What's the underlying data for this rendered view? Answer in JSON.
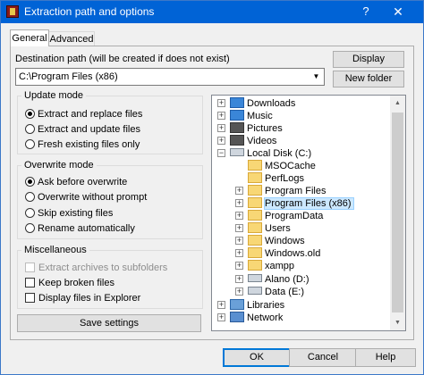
{
  "window": {
    "title": "Extraction path and options",
    "help_label": "?",
    "close_label": "✕"
  },
  "tabs": [
    {
      "label": "General",
      "active": true
    },
    {
      "label": "Advanced",
      "active": false
    }
  ],
  "destination": {
    "label": "Destination path (will be created if does not exist)",
    "value": "C:\\Program Files (x86)",
    "display_button": "Display",
    "new_folder_button": "New folder"
  },
  "update_mode": {
    "title": "Update mode",
    "options": [
      "Extract and replace files",
      "Extract and update files",
      "Fresh existing files only"
    ],
    "selected": 0
  },
  "overwrite_mode": {
    "title": "Overwrite mode",
    "options": [
      "Ask before overwrite",
      "Overwrite without prompt",
      "Skip existing files",
      "Rename automatically"
    ],
    "selected": 0
  },
  "misc": {
    "title": "Miscellaneous",
    "items": [
      {
        "label": "Extract archives to subfolders",
        "checked": false,
        "disabled": true
      },
      {
        "label": "Keep broken files",
        "checked": false,
        "disabled": false
      },
      {
        "label": "Display files in Explorer",
        "checked": false,
        "disabled": false
      }
    ]
  },
  "save_settings_button": "Save settings",
  "tree": [
    {
      "label": "Downloads",
      "icon": "download-folder-icon",
      "expander": "+"
    },
    {
      "label": "Music",
      "icon": "music-folder-icon",
      "expander": "+"
    },
    {
      "label": "Pictures",
      "icon": "pictures-folder-icon",
      "expander": "+"
    },
    {
      "label": "Videos",
      "icon": "videos-folder-icon",
      "expander": "+"
    },
    {
      "label": "Local Disk (C:)",
      "icon": "drive-icon",
      "expander": "-"
    },
    {
      "label": "MSOCache",
      "icon": "folder-icon",
      "expander": ""
    },
    {
      "label": "PerfLogs",
      "icon": "folder-icon",
      "expander": ""
    },
    {
      "label": "Program Files",
      "icon": "folder-icon",
      "expander": "+"
    },
    {
      "label": "Program Files (x86)",
      "icon": "folder-icon",
      "expander": "+",
      "selected": true
    },
    {
      "label": "ProgramData",
      "icon": "folder-icon",
      "expander": "+"
    },
    {
      "label": "Users",
      "icon": "folder-icon",
      "expander": "+"
    },
    {
      "label": "Windows",
      "icon": "folder-icon",
      "expander": "+"
    },
    {
      "label": "Windows.old",
      "icon": "folder-icon",
      "expander": "+"
    },
    {
      "label": "xampp",
      "icon": "folder-icon",
      "expander": "+"
    },
    {
      "label": "Alano (D:)",
      "icon": "drive-icon",
      "expander": "+"
    },
    {
      "label": "Data (E:)",
      "icon": "drive-icon",
      "expander": "+"
    },
    {
      "label": "Libraries",
      "icon": "libraries-icon",
      "expander": "+"
    },
    {
      "label": "Network",
      "icon": "network-icon",
      "expander": "+"
    }
  ],
  "footer": {
    "ok": "OK",
    "cancel": "Cancel",
    "help": "Help"
  },
  "colors": {
    "titlebar": "#0063d6",
    "selection": "#cce8ff",
    "accent": "#0078d7"
  }
}
